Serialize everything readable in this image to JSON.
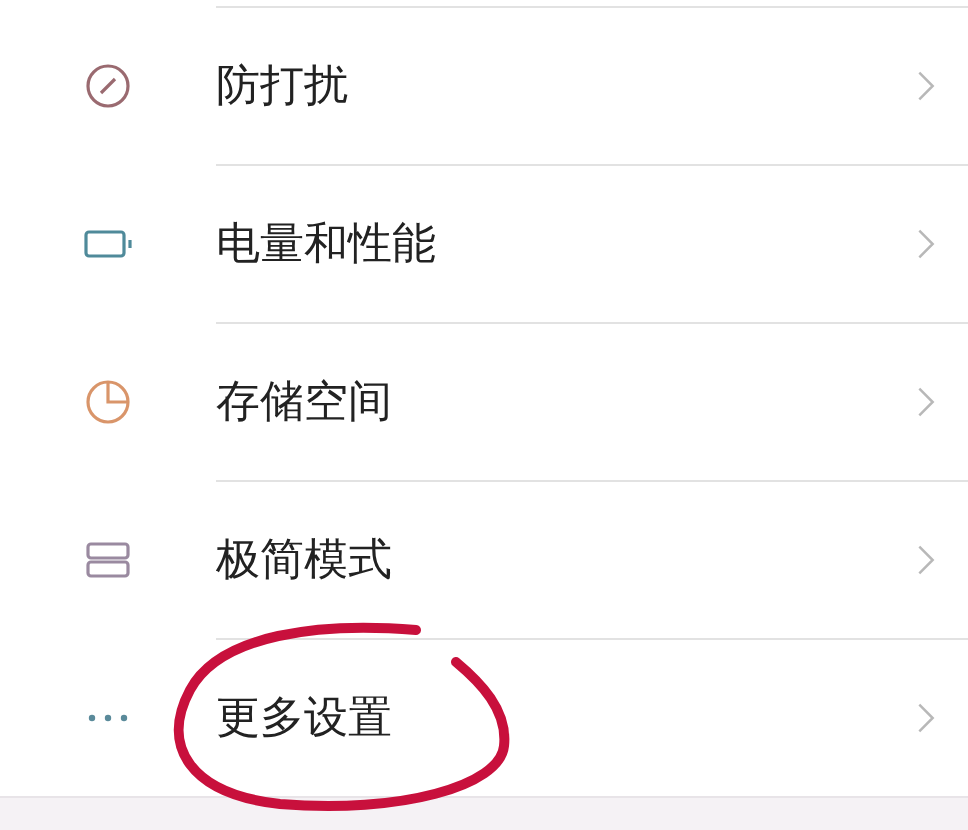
{
  "settings_items": [
    {
      "label": "防打扰",
      "color": "#9a6a70",
      "circled": false
    },
    {
      "label": "电量和性能",
      "color": "#4f8a9a",
      "circled": false
    },
    {
      "label": "存储空间",
      "color": "#d9956a",
      "circled": false
    },
    {
      "label": "极简模式",
      "color": "#9a8aa0",
      "circled": false
    },
    {
      "label": "更多设置",
      "color": "#5a8a9a",
      "circled": true
    }
  ]
}
